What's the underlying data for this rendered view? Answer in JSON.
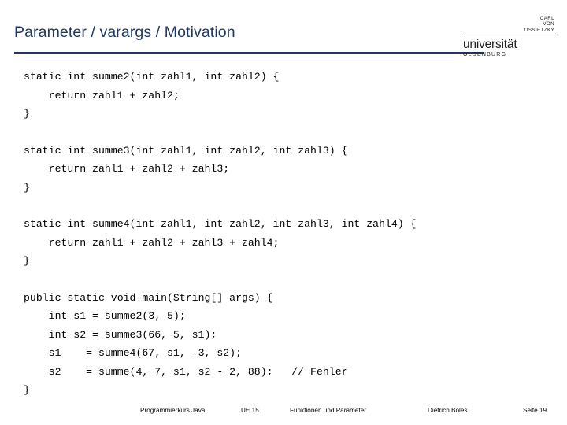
{
  "slide": {
    "title": "Parameter / varargs / Motivation",
    "logo": {
      "line1": "CARL",
      "line2": "VON",
      "line3": "OSSIETZKY",
      "word": "universität",
      "sub": "OLDENBURG"
    },
    "code_blocks": [
      [
        "static int summe2(int zahl1, int zahl2) {",
        "    return zahl1 + zahl2;",
        "}"
      ],
      [
        "static int summe3(int zahl1, int zahl2, int zahl3) {",
        "    return zahl1 + zahl2 + zahl3;",
        "}"
      ],
      [
        "static int summe4(int zahl1, int zahl2, int zahl3, int zahl4) {",
        "    return zahl1 + zahl2 + zahl3 + zahl4;",
        "}"
      ],
      [
        "public static void main(String[] args) {",
        "    int s1 = summe2(3, 5);",
        "    int s2 = summe3(66, 5, s1);",
        "    s1    = summe4(67, s1, -3, s2);",
        "    s2    = summe(4, 7, s1, s2 - 2, 88);   // Fehler",
        "}"
      ]
    ],
    "footer": {
      "course": "Programmierkurs Java",
      "unit": "UE 15",
      "topic": "Funktionen und Parameter",
      "author": "Dietrich Boles",
      "page": "Seite 19"
    }
  }
}
